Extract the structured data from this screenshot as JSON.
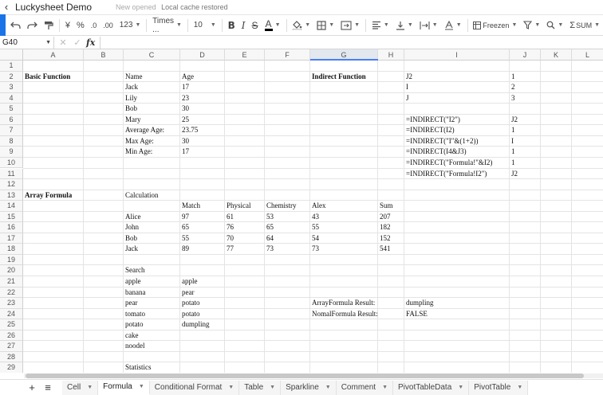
{
  "titlebar": {
    "title": "Luckysheet Demo",
    "cache_label": "New opened",
    "cache_status": "Local cache restored"
  },
  "toolbar": {
    "items": [
      {
        "name": "undo-button",
        "label": "↶"
      },
      {
        "name": "redo-button",
        "label": "↷"
      },
      {
        "name": "format-painter-button",
        "label": "🖌"
      },
      {
        "name": "currency-format-button",
        "label": "¥"
      },
      {
        "name": "percent-format-button",
        "label": "%"
      },
      {
        "name": "decrease-decimal-button",
        "label": ".0"
      },
      {
        "name": "increase-decimal-button",
        "label": ".00"
      },
      {
        "name": "number-format-dropdown",
        "label": "123"
      },
      {
        "name": "font-family-dropdown",
        "label": "Times ..."
      },
      {
        "name": "font-size-dropdown",
        "label": "10"
      },
      {
        "name": "bold-button",
        "label": "B"
      },
      {
        "name": "italic-button",
        "label": "I"
      },
      {
        "name": "strikethrough-button",
        "label": "S"
      },
      {
        "name": "font-color-button",
        "label": "A"
      }
    ],
    "freeze_label": "Freezen",
    "sum_label": "SUM"
  },
  "formulabar": {
    "cell_ref": "G40",
    "formula": ""
  },
  "grid": {
    "columns": [
      "A",
      "B",
      "C",
      "D",
      "E",
      "F",
      "G",
      "H",
      "I",
      "J",
      "K",
      "L"
    ],
    "active_column": "G",
    "rows": [
      "1",
      "2",
      "3",
      "4",
      "5",
      "6",
      "7",
      "8",
      "9",
      "10",
      "11",
      "12",
      "13",
      "14",
      "15",
      "16",
      "17",
      "18",
      "19",
      "20",
      "21",
      "22",
      "23",
      "24",
      "25",
      "26",
      "27",
      "28",
      "29"
    ],
    "cells": [
      {
        "r": 2,
        "c": "A",
        "v": "Basic Function",
        "bold": true
      },
      {
        "r": 2,
        "c": "C",
        "v": "Name"
      },
      {
        "r": 2,
        "c": "D",
        "v": "Age"
      },
      {
        "r": 3,
        "c": "C",
        "v": "Jack"
      },
      {
        "r": 3,
        "c": "D",
        "v": "17"
      },
      {
        "r": 4,
        "c": "C",
        "v": "Lily"
      },
      {
        "r": 4,
        "c": "D",
        "v": "23"
      },
      {
        "r": 5,
        "c": "C",
        "v": "Bob"
      },
      {
        "r": 5,
        "c": "D",
        "v": "30"
      },
      {
        "r": 6,
        "c": "C",
        "v": "Mary"
      },
      {
        "r": 6,
        "c": "D",
        "v": "25"
      },
      {
        "r": 7,
        "c": "C",
        "v": "Average Age:"
      },
      {
        "r": 7,
        "c": "D",
        "v": "23.75"
      },
      {
        "r": 8,
        "c": "C",
        "v": "Max Age:"
      },
      {
        "r": 8,
        "c": "D",
        "v": "30"
      },
      {
        "r": 9,
        "c": "C",
        "v": "Min Age:"
      },
      {
        "r": 9,
        "c": "D",
        "v": "17"
      },
      {
        "r": 2,
        "c": "G",
        "v": "Indirect Function",
        "bold": true
      },
      {
        "r": 2,
        "c": "I",
        "v": "J2"
      },
      {
        "r": 2,
        "c": "J",
        "v": "1"
      },
      {
        "r": 3,
        "c": "I",
        "v": "I"
      },
      {
        "r": 3,
        "c": "J",
        "v": "2"
      },
      {
        "r": 4,
        "c": "I",
        "v": "J"
      },
      {
        "r": 4,
        "c": "J",
        "v": "3"
      },
      {
        "r": 6,
        "c": "I",
        "v": "=INDIRECT(\"I2\")"
      },
      {
        "r": 6,
        "c": "J",
        "v": "J2"
      },
      {
        "r": 7,
        "c": "I",
        "v": "=INDIRECT(I2)"
      },
      {
        "r": 7,
        "c": "J",
        "v": "1"
      },
      {
        "r": 8,
        "c": "I",
        "v": "=INDIRECT(\"I\"&(1+2))"
      },
      {
        "r": 8,
        "c": "J",
        "v": "I"
      },
      {
        "r": 9,
        "c": "I",
        "v": "=INDIRECT(I4&J3)"
      },
      {
        "r": 9,
        "c": "J",
        "v": "1"
      },
      {
        "r": 10,
        "c": "I",
        "v": "=INDIRECT(\"Formula!\"&I2)"
      },
      {
        "r": 10,
        "c": "J",
        "v": "1"
      },
      {
        "r": 11,
        "c": "I",
        "v": "=INDIRECT(\"Formula!I2\")"
      },
      {
        "r": 11,
        "c": "J",
        "v": "J2"
      },
      {
        "r": 13,
        "c": "A",
        "v": "Array Formula",
        "bold": true
      },
      {
        "r": 13,
        "c": "C",
        "v": "Calculation"
      },
      {
        "r": 14,
        "c": "D",
        "v": "Match"
      },
      {
        "r": 14,
        "c": "E",
        "v": "Physical"
      },
      {
        "r": 14,
        "c": "F",
        "v": "Chemistry"
      },
      {
        "r": 14,
        "c": "G",
        "v": "Alex"
      },
      {
        "r": 14,
        "c": "H",
        "v": "Sum"
      },
      {
        "r": 15,
        "c": "C",
        "v": "Alice"
      },
      {
        "r": 15,
        "c": "D",
        "v": "97"
      },
      {
        "r": 15,
        "c": "E",
        "v": "61"
      },
      {
        "r": 15,
        "c": "F",
        "v": "53"
      },
      {
        "r": 15,
        "c": "G",
        "v": "43"
      },
      {
        "r": 15,
        "c": "H",
        "v": "207"
      },
      {
        "r": 16,
        "c": "C",
        "v": "John"
      },
      {
        "r": 16,
        "c": "D",
        "v": "65"
      },
      {
        "r": 16,
        "c": "E",
        "v": "76"
      },
      {
        "r": 16,
        "c": "F",
        "v": "65"
      },
      {
        "r": 16,
        "c": "G",
        "v": "55"
      },
      {
        "r": 16,
        "c": "H",
        "v": "182"
      },
      {
        "r": 17,
        "c": "C",
        "v": "Bob"
      },
      {
        "r": 17,
        "c": "D",
        "v": "55"
      },
      {
        "r": 17,
        "c": "E",
        "v": "70"
      },
      {
        "r": 17,
        "c": "F",
        "v": "64"
      },
      {
        "r": 17,
        "c": "G",
        "v": "54"
      },
      {
        "r": 17,
        "c": "H",
        "v": "152"
      },
      {
        "r": 18,
        "c": "C",
        "v": "Jack"
      },
      {
        "r": 18,
        "c": "D",
        "v": "89"
      },
      {
        "r": 18,
        "c": "E",
        "v": "77"
      },
      {
        "r": 18,
        "c": "F",
        "v": "73"
      },
      {
        "r": 18,
        "c": "G",
        "v": "73"
      },
      {
        "r": 18,
        "c": "H",
        "v": "541"
      },
      {
        "r": 20,
        "c": "C",
        "v": "Search"
      },
      {
        "r": 21,
        "c": "C",
        "v": "apple"
      },
      {
        "r": 21,
        "c": "D",
        "v": "apple"
      },
      {
        "r": 22,
        "c": "C",
        "v": "banana"
      },
      {
        "r": 22,
        "c": "D",
        "v": "pear"
      },
      {
        "r": 23,
        "c": "C",
        "v": "pear"
      },
      {
        "r": 23,
        "c": "D",
        "v": "potato"
      },
      {
        "r": 23,
        "c": "G",
        "v": "ArrayFormula Result:"
      },
      {
        "r": 23,
        "c": "I",
        "v": "dumpling"
      },
      {
        "r": 24,
        "c": "C",
        "v": "tomato"
      },
      {
        "r": 24,
        "c": "D",
        "v": "potato"
      },
      {
        "r": 24,
        "c": "G",
        "v": "NomalFormula Result:"
      },
      {
        "r": 24,
        "c": "I",
        "v": "FALSE"
      },
      {
        "r": 25,
        "c": "C",
        "v": "potato"
      },
      {
        "r": 25,
        "c": "D",
        "v": "dumpling"
      },
      {
        "r": 26,
        "c": "C",
        "v": "cake"
      },
      {
        "r": 27,
        "c": "C",
        "v": "noodel"
      },
      {
        "r": 29,
        "c": "C",
        "v": "Statistics"
      }
    ]
  },
  "sheets": {
    "tabs": [
      {
        "label": "Cell",
        "active": false
      },
      {
        "label": "Formula",
        "active": true
      },
      {
        "label": "Conditional Format",
        "active": false
      },
      {
        "label": "Table",
        "active": false
      },
      {
        "label": "Sparkline",
        "active": false
      },
      {
        "label": "Comment",
        "active": false
      },
      {
        "label": "PivotTableData",
        "active": false
      },
      {
        "label": "PivotTable",
        "active": false
      }
    ]
  },
  "colors": {
    "accent": "#1a73e8",
    "selection": "#4a7ff0"
  }
}
